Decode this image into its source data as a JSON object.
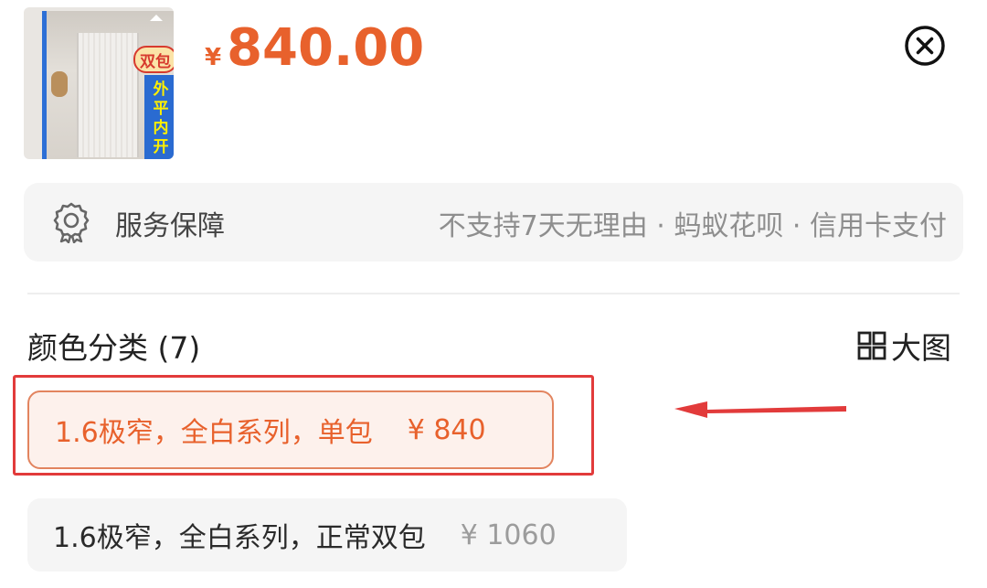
{
  "product": {
    "image_alt": "door product thumbnail",
    "pill_text": "双包",
    "vertical_banner": [
      "外",
      "平",
      "内",
      "开"
    ],
    "price_symbol": "¥",
    "price": "840.00"
  },
  "service": {
    "label": "服务保障",
    "description": "不支持7天无理由 · 蚂蚁花呗 · 信用卡支付"
  },
  "section": {
    "title": "颜色分类 (7)",
    "big_picture_label": "大图"
  },
  "options": [
    {
      "name": "1.6极窄，全白系列，单包",
      "price": "¥ 840",
      "selected": true
    },
    {
      "name": "1.6极窄，全白系列，正常双包",
      "price": "¥ 1060",
      "selected": false
    }
  ],
  "colors": {
    "accent": "#e8612c",
    "annotation_red": "#e23b3b",
    "chip_bg": "#f5f5f5"
  },
  "icons": {
    "close": "close-circle-icon",
    "service": "award-badge-icon",
    "big_picture": "grid-icon"
  }
}
